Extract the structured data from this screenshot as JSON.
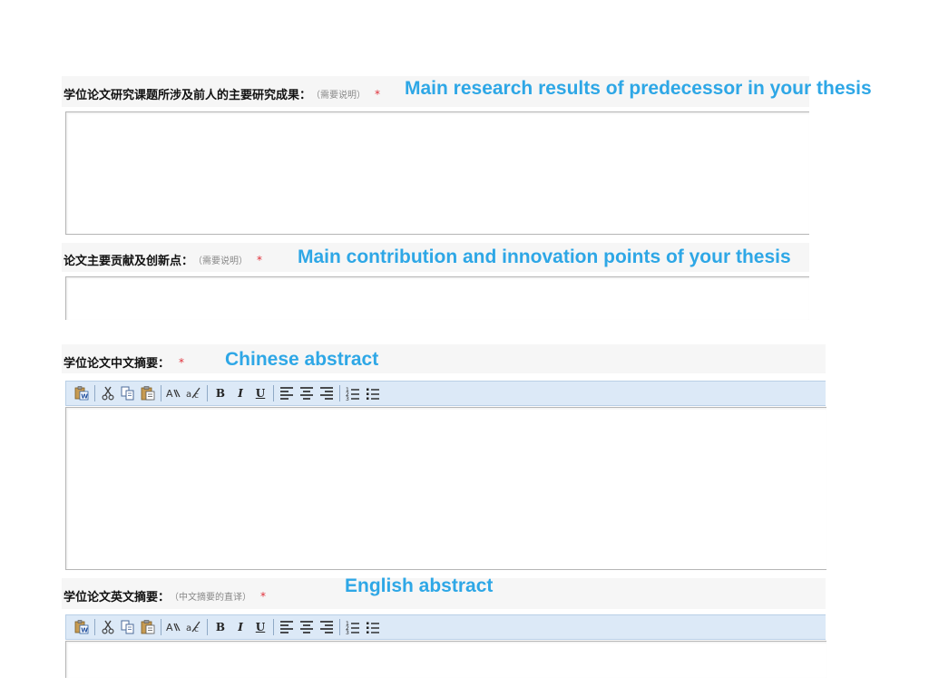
{
  "sections": [
    {
      "label": "学位论文研究课题所涉及前人的主要研究成果：",
      "hint": "（需要说明）",
      "required_mark": "*",
      "annotation": "Main research results of predecessor in your thesis",
      "value": ""
    },
    {
      "label": "论文主要贡献及创新点：",
      "hint": "（需要说明）",
      "required_mark": "*",
      "annotation": "Main contribution and innovation points of your thesis",
      "value": ""
    },
    {
      "label": "学位论文中文摘要：",
      "hint": "",
      "required_mark": "*",
      "annotation": "Chinese abstract",
      "value": ""
    },
    {
      "label": "学位论文英文摘要：",
      "hint": "（中文摘要的直译）",
      "required_mark": "*",
      "annotation": "English abstract",
      "value": ""
    }
  ],
  "toolbar": {
    "bold": "B",
    "italic": "I",
    "underline": "U",
    "buttons": [
      "paste-word-icon",
      "cut-icon",
      "copy-icon",
      "paste-icon",
      "find-icon",
      "replace-icon",
      "bold-icon",
      "italic-icon",
      "underline-icon",
      "align-left-icon",
      "align-center-icon",
      "align-right-icon",
      "ordered-list-icon",
      "unordered-list-icon"
    ]
  },
  "colors": {
    "annotation": "#2ea7e6",
    "required": "#e0303a",
    "toolbar_bg": "#dce9f7"
  }
}
